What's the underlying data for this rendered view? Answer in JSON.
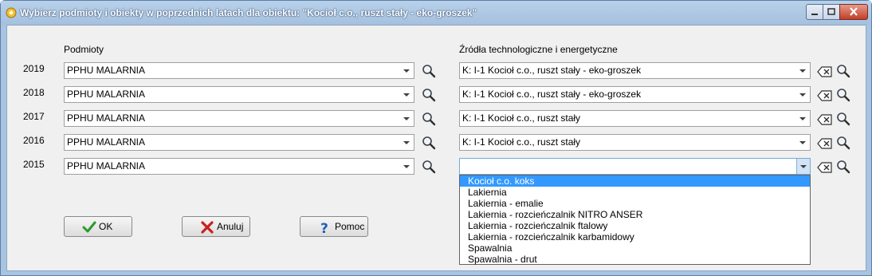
{
  "window": {
    "title": "Wybierz podmioty i obiekty w poprzednich latach  dla obiektu: \"Kocioł c.o., ruszt stały - eko-groszek\""
  },
  "headers": {
    "podmioty": "Podmioty",
    "zrodla": "Źródła technologiczne i energetyczne"
  },
  "rows": [
    {
      "year": "2019",
      "podmiot": "PPHU MALARNIA",
      "zrodlo": "K: I-1  Kocioł c.o., ruszt stały - eko-groszek"
    },
    {
      "year": "2018",
      "podmiot": "PPHU MALARNIA",
      "zrodlo": "K: I-1  Kocioł c.o., ruszt stały - eko-groszek"
    },
    {
      "year": "2017",
      "podmiot": "PPHU MALARNIA",
      "zrodlo": "K: I-1  Kocioł c.o., ruszt stały"
    },
    {
      "year": "2016",
      "podmiot": "PPHU MALARNIA",
      "zrodlo": "K: I-1  Kocioł c.o., ruszt stały"
    },
    {
      "year": "2015",
      "podmiot": "PPHU MALARNIA",
      "zrodlo": ""
    }
  ],
  "dropdown": {
    "options": [
      "Kocioł c.o. koks",
      "Lakiernia",
      "Lakiernia - emalie",
      "Lakiernia - rozcieńczalnik NITRO ANSER",
      "Lakiernia - rozcieńczalnik ftalowy",
      "Lakiernia - rozcieńczalnik karbamidowy",
      "Spawalnia",
      "Spawalnia - drut"
    ],
    "selected_index": 0
  },
  "buttons": {
    "ok": "OK",
    "anuluj": "Anuluj",
    "pomoc": "Pomoc"
  },
  "icons": {
    "search": "magnifier-icon",
    "clear": "clear-field-icon",
    "ok": "checkmark-icon",
    "cancel": "x-icon",
    "help": "question-icon"
  },
  "colors": {
    "title_bar": "#a9c4e0",
    "dropdown_highlight": "#3399ff",
    "ok_check": "#2a9a2a",
    "cancel_x": "#c82020",
    "help_q": "#1e5fb8"
  }
}
